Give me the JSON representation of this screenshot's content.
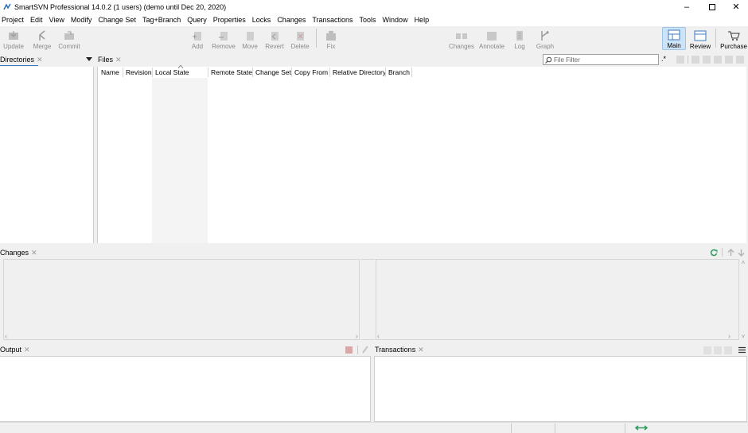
{
  "window": {
    "title": "SmartSVN Professional 14.0.2 (1 users)  (demo until Dec 20, 2020)"
  },
  "menu": [
    "Project",
    "Edit",
    "View",
    "Modify",
    "Change Set",
    "Tag+Branch",
    "Query",
    "Properties",
    "Locks",
    "Changes",
    "Transactions",
    "Tools",
    "Window",
    "Help"
  ],
  "toolbar": {
    "update": "Update",
    "merge": "Merge",
    "commit": "Commit",
    "add": "Add",
    "remove": "Remove",
    "move": "Move",
    "revert": "Revert",
    "delete": "Delete",
    "fix": "Fix",
    "changes": "Changes",
    "annotate": "Annotate",
    "log": "Log",
    "graph": "Graph",
    "main": "Main",
    "review": "Review",
    "purchase": "Purchase"
  },
  "panes": {
    "directories": "Directories",
    "files": "Files",
    "changes": "Changes",
    "output": "Output",
    "transactions": "Transactions"
  },
  "filter": {
    "placeholder": "File Filter",
    "regex": ".*"
  },
  "columns": [
    "Name",
    "Revision",
    "Local State",
    "Remote State",
    "Change Set",
    "Copy From",
    "Relative Directory",
    "Branch"
  ]
}
